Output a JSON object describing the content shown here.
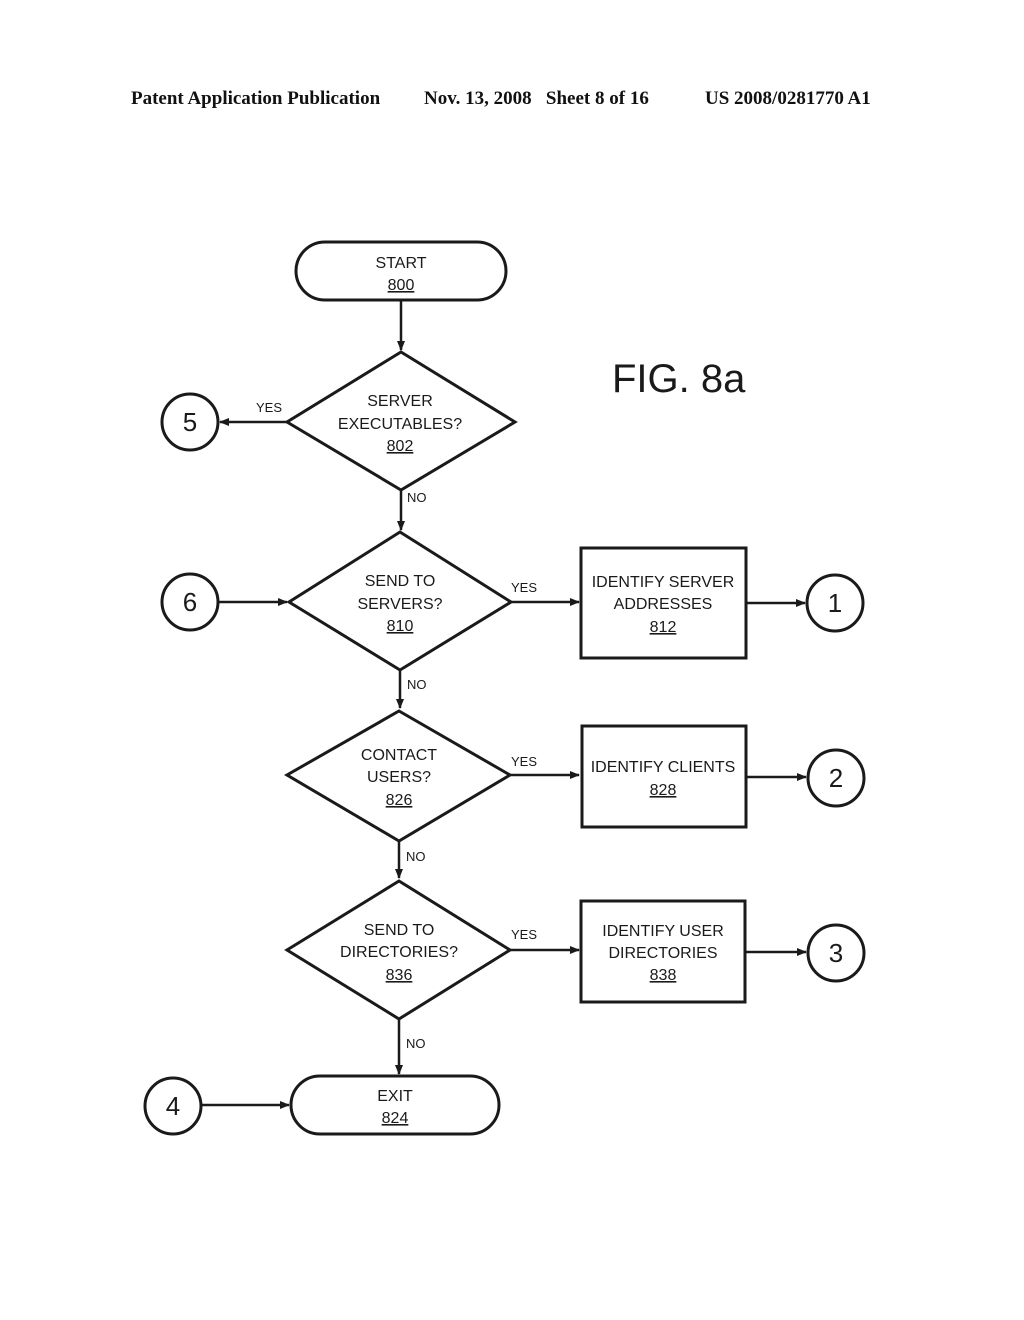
{
  "header": {
    "publication": "Patent Application Publication",
    "date_sheet": "Nov. 13, 2008   Sheet 8 of 16",
    "number": "US 2008/0281770 A1"
  },
  "figure_label": "FIG. 8a",
  "nodes": {
    "start": {
      "line1": "START",
      "ref": "800"
    },
    "d802": {
      "line1": "SERVER",
      "line2": "EXECUTABLES?",
      "ref": "802"
    },
    "d810": {
      "line1": "SEND TO",
      "line2": "SERVERS?",
      "ref": "810"
    },
    "b812": {
      "line1": "IDENTIFY SERVER",
      "line2": "ADDRESSES",
      "ref": "812"
    },
    "d826": {
      "line1": "CONTACT",
      "line2": "USERS?",
      "ref": "826"
    },
    "b828": {
      "line1": "IDENTIFY CLIENTS",
      "ref": "828"
    },
    "d836": {
      "line1": "SEND TO",
      "line2": "DIRECTORIES?",
      "ref": "836"
    },
    "b838": {
      "line1": "IDENTIFY USER",
      "line2": "DIRECTORIES",
      "ref": "838"
    },
    "exit": {
      "line1": "EXIT",
      "ref": "824"
    }
  },
  "connectors": {
    "c1": "1",
    "c2": "2",
    "c3": "3",
    "c4": "4",
    "c5": "5",
    "c6": "6"
  },
  "edge_labels": {
    "yes": "YES",
    "no": "NO"
  }
}
